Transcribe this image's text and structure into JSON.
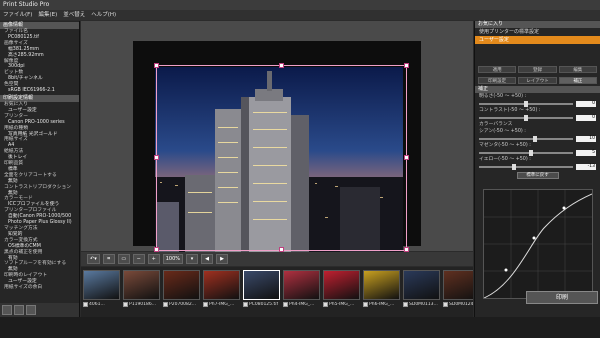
{
  "app": {
    "title": "Print Studio Pro"
  },
  "menu": [
    "ファイル(F)",
    "編集(E)",
    "並べ替え",
    "ヘルプ(H)"
  ],
  "left_panel": {
    "image_info": {
      "header": "画像情報",
      "lines": [
        {
          "text": "ファイル名",
          "value": false
        },
        {
          "text": "PC080125.tif",
          "value": true
        },
        {
          "text": "画像サイズ",
          "value": false
        },
        {
          "text": "幅381.25mm",
          "value": true
        },
        {
          "text": "高さ285.92mm",
          "value": true
        },
        {
          "text": "解像度",
          "value": false
        },
        {
          "text": "300dpi",
          "value": true
        },
        {
          "text": "ビット数",
          "value": false
        },
        {
          "text": "8bit/チャンネル",
          "value": true
        },
        {
          "text": "色空間",
          "value": false
        },
        {
          "text": "sRGB IEC61966-2.1",
          "value": true
        }
      ]
    },
    "print_settings": {
      "header": "印刷設定情報",
      "lines": [
        {
          "text": "お気に入り",
          "value": false
        },
        {
          "text": "ユーザー設定",
          "value": true
        },
        {
          "text": "プリンター",
          "value": false
        },
        {
          "text": "Canon PRO-1000 series",
          "value": true
        },
        {
          "text": "用紙の種類",
          "value": false
        },
        {
          "text": "写真用紙 光沢ゴールド",
          "value": true
        },
        {
          "text": "用紙サイズ",
          "value": false
        },
        {
          "text": "A4",
          "value": true
        },
        {
          "text": "給紙方法",
          "value": false
        },
        {
          "text": "後トレイ",
          "value": true
        },
        {
          "text": "印刷品質",
          "value": false
        },
        {
          "text": "標準",
          "value": true
        },
        {
          "text": "全面をクリアコートする",
          "value": false
        },
        {
          "text": "無効",
          "value": true
        },
        {
          "text": "コントラストリプロダクション",
          "value": false
        },
        {
          "text": "無効",
          "value": true
        },
        {
          "text": "カラーモード",
          "value": false
        },
        {
          "text": "ICCプロファイルを使う",
          "value": true
        },
        {
          "text": "プリンタープロファイル",
          "value": false
        },
        {
          "text": "自動(Canon PRO-1000/500",
          "value": true
        },
        {
          "text": "Photo Paper Plus Glossy II)",
          "value": true
        },
        {
          "text": "マッチング方法",
          "value": false
        },
        {
          "text": "知覚的",
          "value": true
        },
        {
          "text": "カラー変換方式",
          "value": false
        },
        {
          "text": "OS標準のCMM",
          "value": true
        },
        {
          "text": "黒点の補正を使用",
          "value": false
        },
        {
          "text": "有効",
          "value": true
        },
        {
          "text": "ソフトプルーフを有効にする",
          "value": false
        },
        {
          "text": "無効",
          "value": true
        },
        {
          "text": "印刷時のレイアウト",
          "value": false
        },
        {
          "text": "ユーザー設定",
          "value": true
        },
        {
          "text": "用紙サイズの余白",
          "value": false
        }
      ]
    }
  },
  "toolbar": {
    "zoom": "100%"
  },
  "thumbnails": [
    {
      "name": "4061...",
      "color": "#5a7aa0",
      "active": false
    },
    {
      "name": "P1190186...",
      "color": "#7a4a3a",
      "active": false
    },
    {
      "name": "P2070082...",
      "color": "#6a2a1a",
      "active": false
    },
    {
      "name": "Ph7-IMG_...",
      "color": "#a03020",
      "active": false
    },
    {
      "name": "PC080125.tif",
      "color": "#3a4a6a",
      "active": true
    },
    {
      "name": "Ph4-IMG_...",
      "color": "#b03040",
      "active": false
    },
    {
      "name": "Ph5-IMG_...",
      "color": "#c02030",
      "active": false
    },
    {
      "name": "Ph6-IMG_...",
      "color": "#c8a020",
      "active": false
    },
    {
      "name": "SD0M0113...",
      "color": "#2a3a5a",
      "active": false
    },
    {
      "name": "SD0M0124...",
      "color": "#603020",
      "active": false
    }
  ],
  "right_panel": {
    "favorites_header": "お気に入り",
    "favorites": [
      {
        "label": "使用プリンターの標準設定",
        "on": false
      },
      {
        "label": "ユーザー設定",
        "on": true
      }
    ],
    "actions": [
      "適用",
      "登録",
      "編集"
    ],
    "tabs": [
      {
        "label": "印刷設定",
        "on": false
      },
      {
        "label": "レイアウト",
        "on": false
      },
      {
        "label": "補正",
        "on": true
      }
    ],
    "correction_header": "補正",
    "brightness": {
      "label": "明るさ(-50 ～ +50) :",
      "value": "0",
      "pos": 0.5
    },
    "contrast": {
      "label": "コントラスト(-50 ～ +50) :",
      "value": "0",
      "pos": 0.5
    },
    "color_balance_label": "カラーバランス",
    "cyan": {
      "label": "シアン(-50 ～ +50) :",
      "value": "10",
      "pos": 0.6
    },
    "magenta": {
      "label": "マゼンタ(-50 ～ +50) :",
      "value": "5",
      "pos": 0.55
    },
    "yellow": {
      "label": "イエロー(-50 ～ +50) :",
      "value": "-13",
      "pos": 0.37
    },
    "reset_label": "標準に戻す",
    "print_label": "印刷"
  },
  "colors": {
    "accent": "#e38a1c",
    "selection": "#f0a0c8"
  }
}
